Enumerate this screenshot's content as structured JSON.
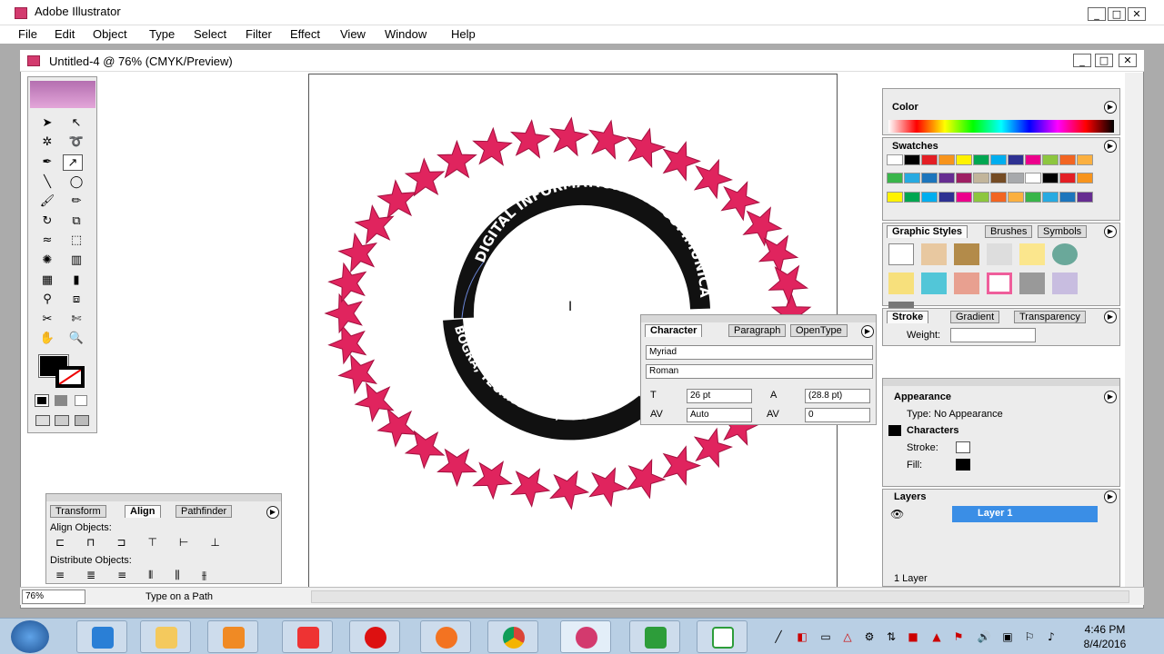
{
  "app": {
    "title": "Adobe Illustrator",
    "window_buttons": [
      "_",
      "□",
      "✕"
    ]
  },
  "menu": [
    "File",
    "Edit",
    "Object",
    "Type",
    "Select",
    "Filter",
    "Effect",
    "View",
    "Window",
    "Help"
  ],
  "document": {
    "title": "Untitled-4 @ 76% (CMYK/Preview)",
    "window_buttons": [
      "_",
      "□",
      "✕"
    ]
  },
  "artwork": {
    "outer_text": "DIGITAL INFORMATION AND COMMUNICATION TECHNOLOGY, BOGRA",
    "star_color": "#e0245e",
    "star_count": 36
  },
  "character_panel": {
    "tabs": [
      "Character",
      "Paragraph",
      "OpenType"
    ],
    "font": "Myriad",
    "style": "Roman",
    "size": "26 pt",
    "leading": "(28.8 pt)",
    "kerning": "Auto",
    "tracking": "0"
  },
  "align_panel": {
    "tabs": [
      "Transform",
      "Align",
      "Pathfinder"
    ],
    "align_label": "Align Objects:",
    "distribute_label": "Distribute Objects:"
  },
  "color_panel": {
    "title": "Color"
  },
  "swatches_panel": {
    "title": "Swatches",
    "colors": [
      "#ffffff",
      "#000000",
      "#e31e24",
      "#f7941d",
      "#fff200",
      "#00a651",
      "#00aeef",
      "#2e3192",
      "#ec008c",
      "#8dc63f",
      "#f26522",
      "#fbb040",
      "#39b54a",
      "#27aae1",
      "#1c75bc",
      "#662d91",
      "#9e1f63",
      "#c2b59b",
      "#754c24",
      "#a7a9ac"
    ]
  },
  "graphic_styles_panel": {
    "tabs": [
      "Graphic Styles",
      "Brushes",
      "Symbols"
    ]
  },
  "stroke_panel": {
    "tabs": [
      "Stroke",
      "Gradient",
      "Transparency"
    ],
    "weight_label": "Weight:"
  },
  "appearance_panel": {
    "title": "Appearance",
    "type_line": "Type: No Appearance",
    "characters": "Characters",
    "stroke_label": "Stroke:",
    "fill_label": "Fill:"
  },
  "layers_panel": {
    "title": "Layers",
    "layer_name": "Layer 1",
    "footer": "1 Layer"
  },
  "status": {
    "zoom": "76%",
    "tool": "Type on a Path"
  },
  "taskbar": {
    "time": "4:46 PM",
    "date": "8/4/2016"
  }
}
